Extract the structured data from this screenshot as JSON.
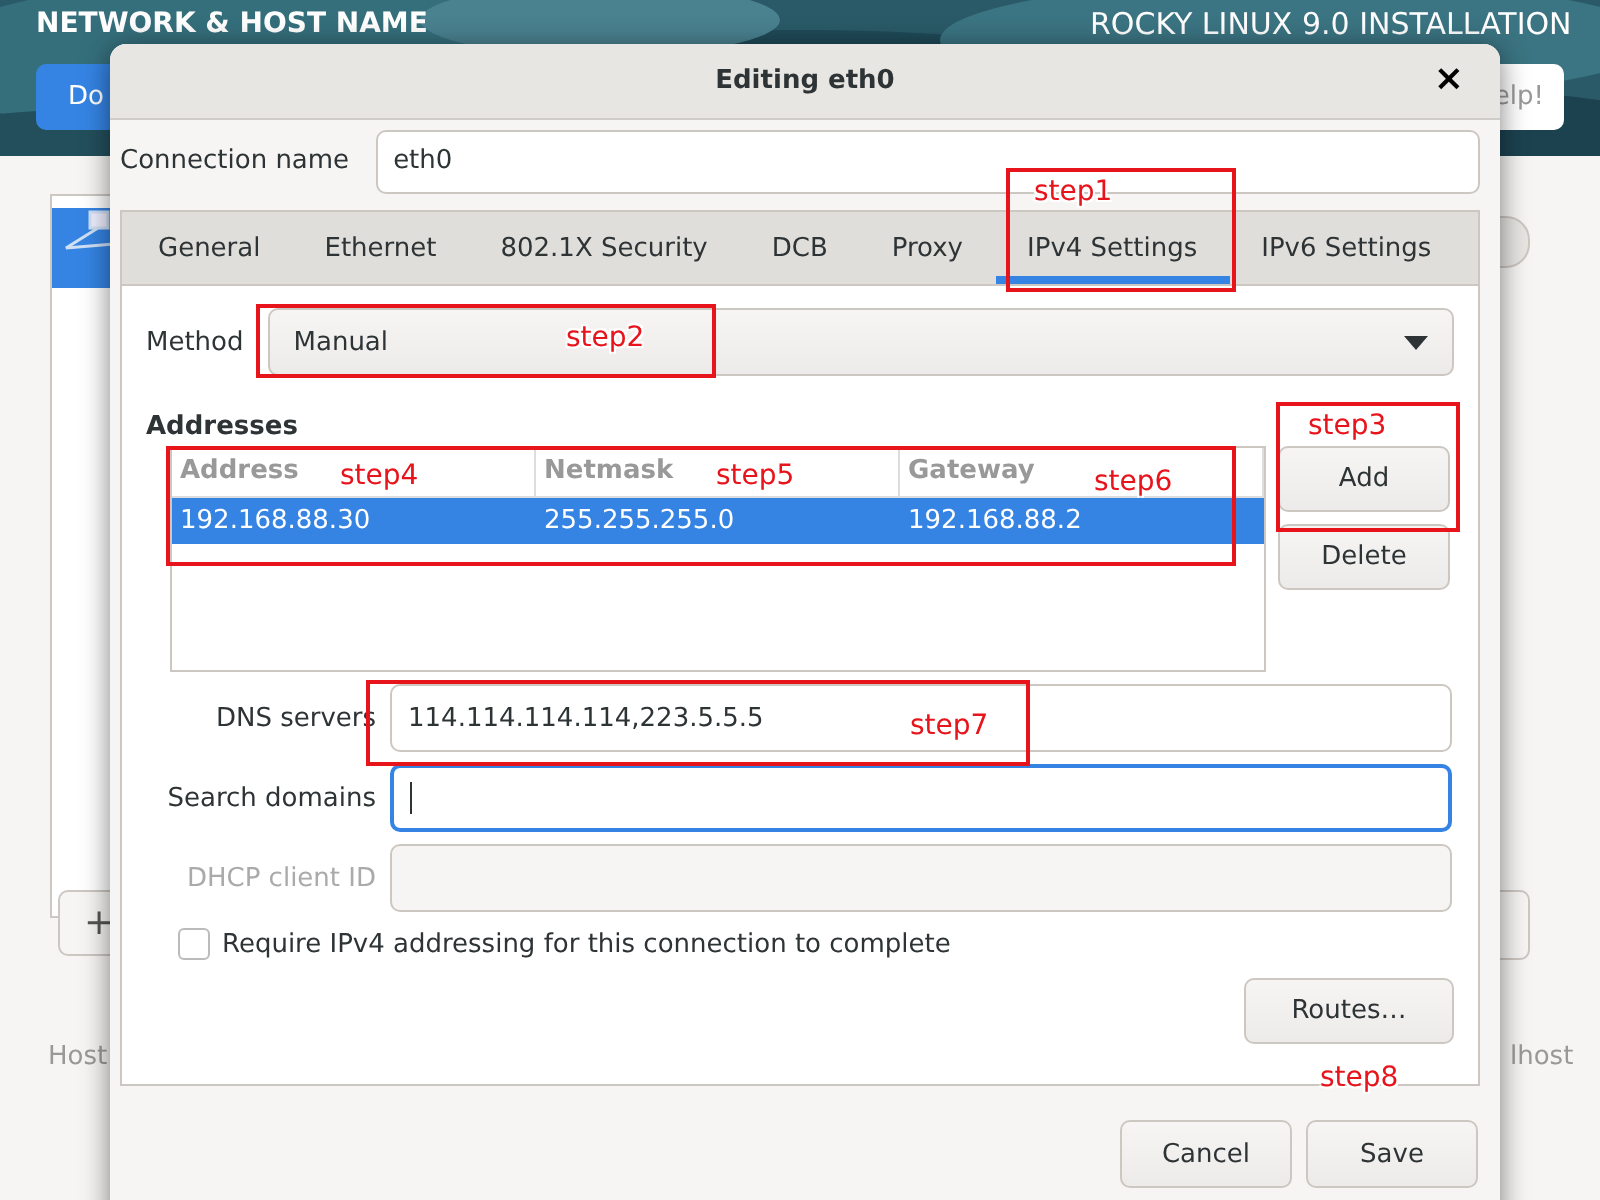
{
  "background": {
    "title": "NETWORK & HOST NAME",
    "installer_title": "ROCKY LINUX 9.0 INSTALLATION",
    "done_button": "Do",
    "help_button": "elp!",
    "add_device_button": "+",
    "hostname_label": "Host",
    "hostname_value": "lhost",
    "devices": [
      {
        "selected": true
      }
    ],
    "switch": {
      "on": false
    }
  },
  "dialog": {
    "title": "Editing eth0",
    "close": "×",
    "connection_name_label": "Connection name",
    "connection_name": "eth0",
    "tabs": [
      {
        "label": "General",
        "selected": false
      },
      {
        "label": "Ethernet",
        "selected": false
      },
      {
        "label": "802.1X Security",
        "selected": false
      },
      {
        "label": "DCB",
        "selected": false
      },
      {
        "label": "Proxy",
        "selected": false
      },
      {
        "label": "IPv4 Settings",
        "selected": true
      },
      {
        "label": "IPv6 Settings",
        "selected": false
      }
    ],
    "method_label": "Method",
    "method": "Manual",
    "addresses_heading": "Addresses",
    "columns": [
      "Address",
      "Netmask",
      "Gateway"
    ],
    "rows": [
      {
        "cells": [
          "192.168.88.30",
          "255.255.255.0",
          "192.168.88.2"
        ],
        "selected": true
      }
    ],
    "add_button": "Add",
    "delete_button": "Delete",
    "fields": [
      {
        "label": "DNS servers",
        "value": "114.114.114.114,223.5.5.5",
        "focused": false,
        "disabled": false
      },
      {
        "label": "Search domains",
        "focused": true,
        "disabled": false
      },
      {
        "label": "DHCP client ID",
        "focused": false,
        "disabled": true
      }
    ],
    "require_checkbox": {
      "label": "Require IPv4 addressing for this connection to complete",
      "checked": false
    },
    "routes_button": "Routes…",
    "cancel_button": "Cancel",
    "save_button": "Save"
  },
  "annotations": [
    {
      "label": "step1"
    },
    {
      "label": "step2"
    },
    {
      "label": "step3"
    },
    {
      "label": "step4"
    },
    {
      "label": "step5"
    },
    {
      "label": "step6"
    },
    {
      "label": "step7"
    },
    {
      "label": "step8"
    }
  ]
}
